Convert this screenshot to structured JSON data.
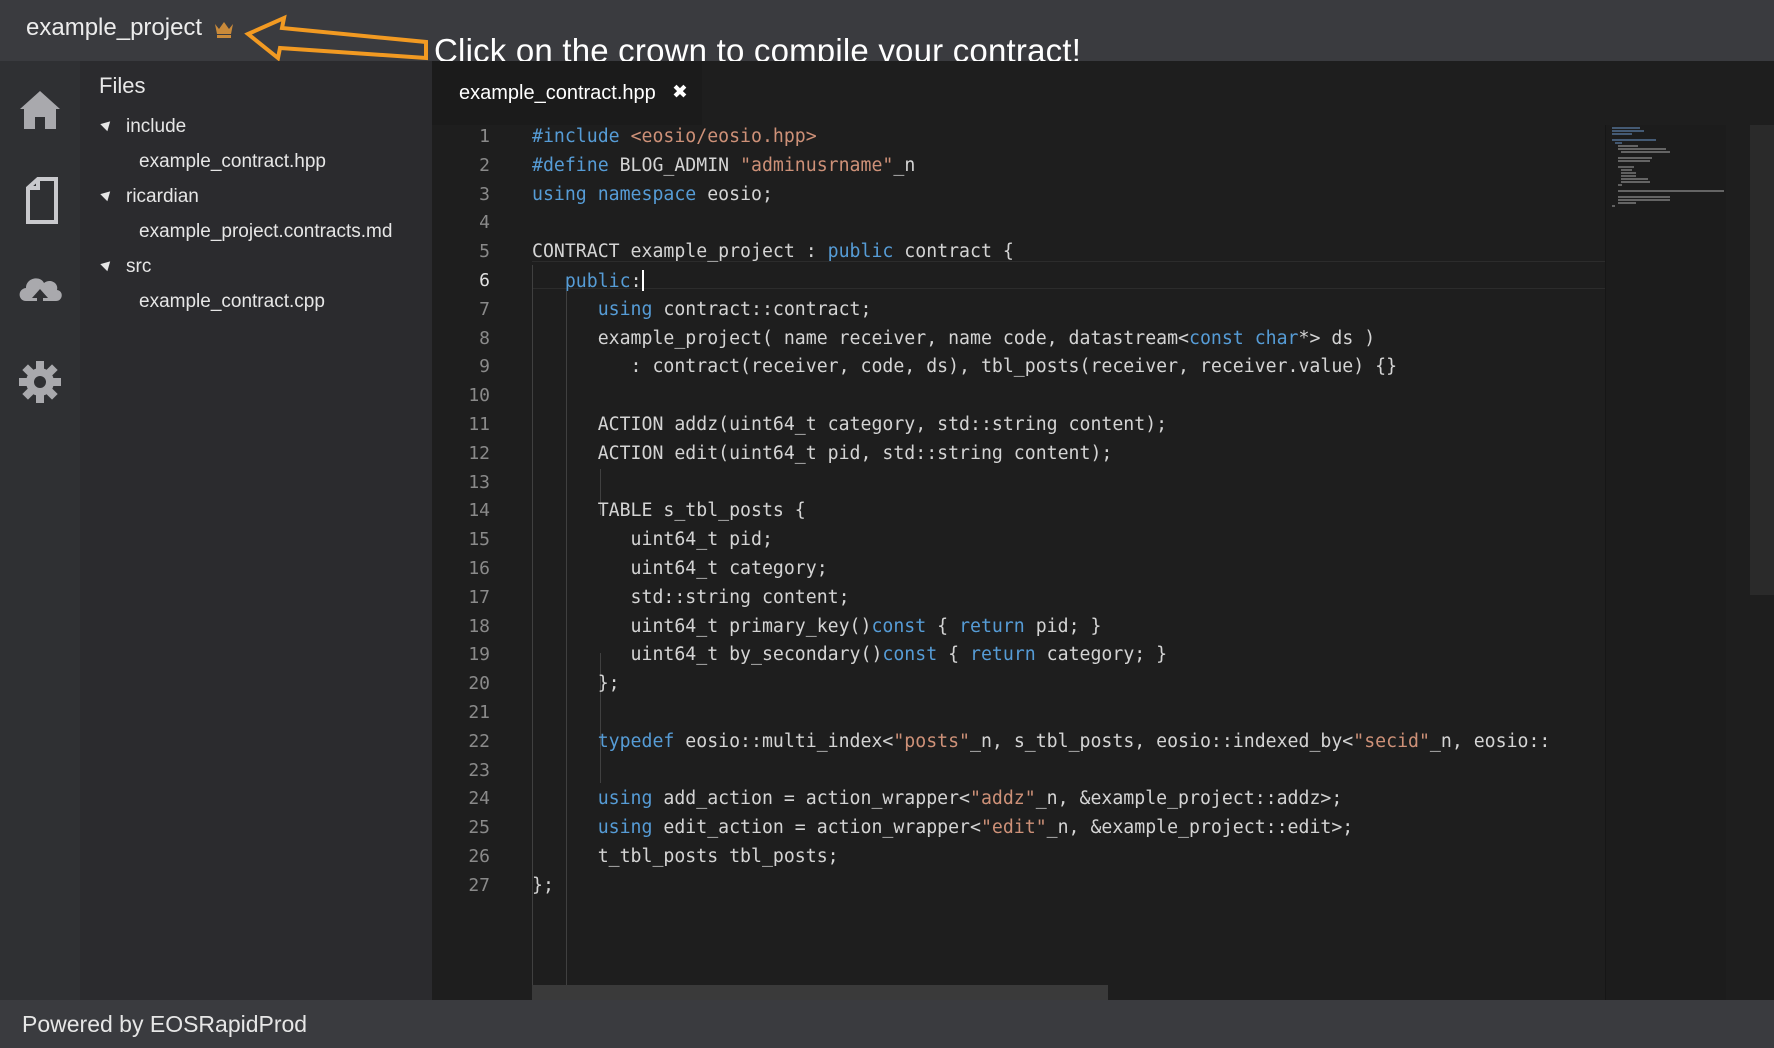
{
  "header": {
    "project_name": "example_project",
    "crown_icon": "crown-icon",
    "hint": "Click on the crown to compile your contract!",
    "accent": "#e8942a"
  },
  "sidebar": {
    "icons": [
      "home-icon",
      "file-icon",
      "cloud-upload-icon",
      "gear-icon"
    ]
  },
  "files": {
    "title": "Files",
    "folders": [
      {
        "name": "include",
        "files": [
          "example_contract.hpp"
        ]
      },
      {
        "name": "ricardian",
        "files": [
          "example_project.contracts.md"
        ]
      },
      {
        "name": "src",
        "files": [
          "example_contract.cpp"
        ]
      }
    ]
  },
  "editor": {
    "tab_label": "example_contract.hpp",
    "close_glyph": "✖",
    "active_line": 6,
    "line_numbers": [
      "1",
      "2",
      "3",
      "4",
      "5",
      "6",
      "7",
      "8",
      "9",
      "10",
      "11",
      "12",
      "13",
      "14",
      "15",
      "16",
      "17",
      "18",
      "19",
      "20",
      "21",
      "22",
      "23",
      "24",
      "25",
      "26",
      "27"
    ],
    "lines": [
      "#include <eosio/eosio.hpp>",
      "#define BLOG_ADMIN \"adminusrname\"_n",
      "using namespace eosio;",
      "",
      "CONTRACT example_project : public contract {",
      "   public:",
      "      using contract::contract;",
      "      example_project( name receiver, name code, datastream<const char*> ds )",
      "         : contract(receiver, code, ds), tbl_posts(receiver, receiver.value) {}",
      "",
      "      ACTION addz(uint64_t category, std::string content);",
      "      ACTION edit(uint64_t pid, std::string content);",
      "",
      "      TABLE s_tbl_posts {",
      "         uint64_t pid;",
      "         uint64_t category;",
      "         std::string content;",
      "         uint64_t primary_key()const { return pid; }",
      "         uint64_t by_secondary()const { return category; }",
      "      };",
      "",
      "      typedef eosio::multi_index<\"posts\"_n, s_tbl_posts, eosio::indexed_by<\"secid\"_n, eosio::",
      "",
      "      using add_action = action_wrapper<\"addz\"_n, &example_project::addz>;",
      "      using edit_action = action_wrapper<\"edit\"_n, &example_project::edit>;",
      "      t_tbl_posts tbl_posts;",
      "};"
    ]
  },
  "footer": {
    "text": "Powered by EOSRapidProd"
  }
}
